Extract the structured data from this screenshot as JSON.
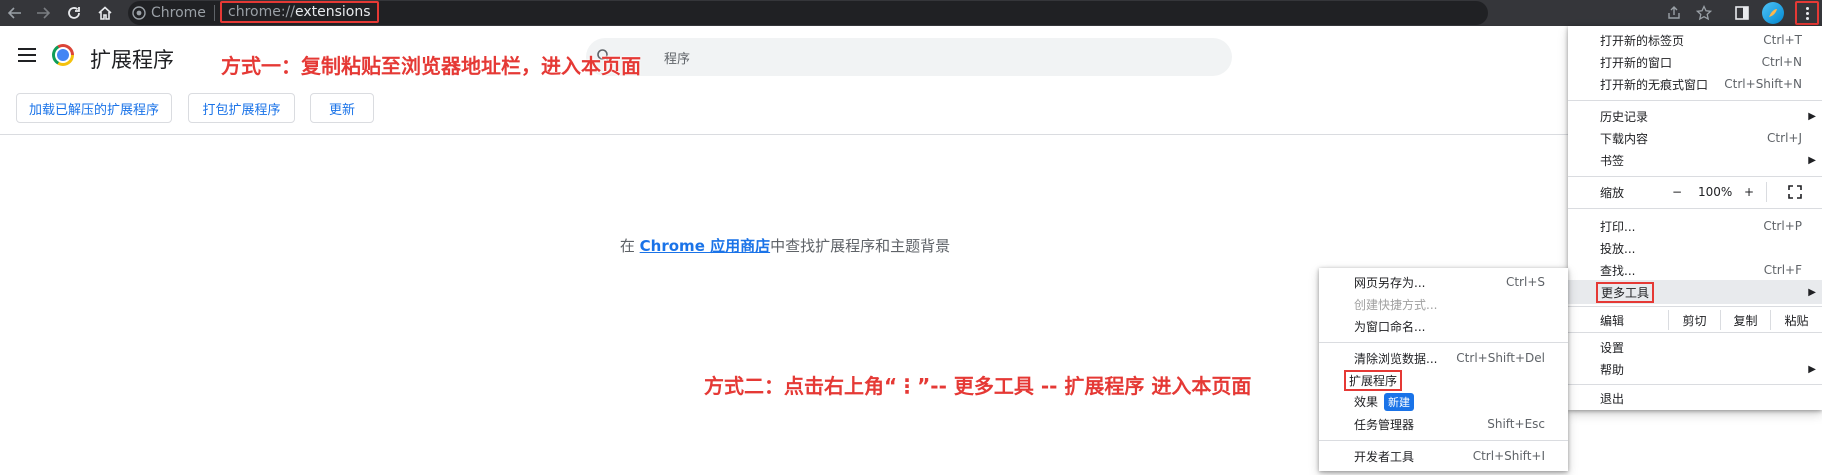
{
  "browser": {
    "brand_label": "Chrome",
    "url_scheme": "chrome://",
    "url_path": "extensions"
  },
  "page": {
    "title": "扩展程序",
    "search_placeholder": "程序",
    "buttons": {
      "load_unpacked": "加载已解压的扩展程序",
      "pack": "打包扩展程序",
      "update": "更新"
    },
    "empty_prefix": "在",
    "store_link": "Chrome 应用商店",
    "empty_suffix": "中查找扩展程序和主题背景"
  },
  "annotations": {
    "method_one": "方式一：复制粘贴至浏览器地址栏，进入本页面",
    "method_two": "方式二：点击右上角“⋮”-- 更多工具 -- 扩展程序 进入本页面"
  },
  "main_menu": {
    "new_tab": "打开新的标签页",
    "new_tab_sc": "Ctrl+T",
    "new_window": "打开新的窗口",
    "new_window_sc": "Ctrl+N",
    "incognito": "打开新的无痕式窗口",
    "incognito_sc": "Ctrl+Shift+N",
    "history": "历史记录",
    "downloads": "下载内容",
    "downloads_sc": "Ctrl+J",
    "bookmarks": "书签",
    "zoom": "缩放",
    "zoom_minus": "−",
    "zoom_value": "100%",
    "zoom_plus": "+",
    "print": "打印...",
    "print_sc": "Ctrl+P",
    "cast": "投放...",
    "find": "查找...",
    "find_sc": "Ctrl+F",
    "more_tools": "更多工具",
    "edit": "编辑",
    "cut": "剪切",
    "copy": "复制",
    "paste": "粘贴",
    "settings": "设置",
    "help": "帮助",
    "exit": "退出"
  },
  "sub_menu": {
    "save_page": "网页另存为...",
    "save_page_sc": "Ctrl+S",
    "create_shortcut": "创建快捷方式...",
    "name_window": "为窗口命名...",
    "clear_data": "清除浏览数据...",
    "clear_data_sc": "Ctrl+Shift+Del",
    "extensions": "扩展程序",
    "effects": "效果",
    "effects_badge": "新建",
    "task_manager": "任务管理器",
    "task_manager_sc": "Shift+Esc",
    "dev_tools": "开发者工具",
    "dev_tools_sc": "Ctrl+Shift+I"
  },
  "icons": [
    "back-icon",
    "forward-icon",
    "reload-icon",
    "home-icon",
    "share-icon",
    "star-icon",
    "side-panel-icon",
    "avatar-icon",
    "more-vert-icon",
    "hamburger-icon",
    "chrome-logo-icon",
    "search-icon",
    "fullscreen-icon",
    "chevron-right-icon"
  ],
  "colors": {
    "accent": "#1a73e8",
    "annotation": "#e53935",
    "toolbar": "#35363a"
  }
}
